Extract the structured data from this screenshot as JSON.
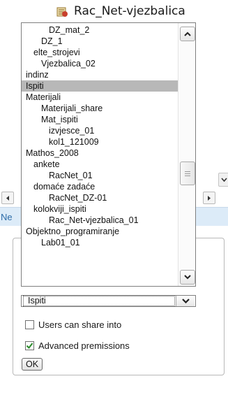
{
  "background": {
    "tree_top_item": "Rac_Net-vjezbalica",
    "status_text": "Ne"
  },
  "folder_list": {
    "items": [
      {
        "label": "DZ_mat_2",
        "indent": 3
      },
      {
        "label": "DZ_1",
        "indent": 2
      },
      {
        "label": "elte_strojevi",
        "indent": 1
      },
      {
        "label": "Vjezbalica_02",
        "indent": 2
      },
      {
        "label": "indinz",
        "indent": 0
      },
      {
        "label": "Ispiti",
        "indent": 0,
        "selected": true
      },
      {
        "label": "Materijali",
        "indent": 0
      },
      {
        "label": "Materijali_share",
        "indent": 2
      },
      {
        "label": "Mat_ispiti",
        "indent": 2
      },
      {
        "label": "izvjesce_01",
        "indent": 3
      },
      {
        "label": "kol1_121009",
        "indent": 3
      },
      {
        "label": "Mathos_2008",
        "indent": 0
      },
      {
        "label": "ankete",
        "indent": 1
      },
      {
        "label": "RacNet_01",
        "indent": 3
      },
      {
        "label": "domaće zadaće",
        "indent": 1
      },
      {
        "label": "RacNet_DZ-01",
        "indent": 3
      },
      {
        "label": "kolokviji_ispiti",
        "indent": 1
      },
      {
        "label": "Rac_Net-vjezbalica_01",
        "indent": 3
      },
      {
        "label": "Objektno_programiranje",
        "indent": 0
      },
      {
        "label": "Lab01_01",
        "indent": 2
      }
    ]
  },
  "folder_select": {
    "value": "Ispiti"
  },
  "options": {
    "users_can_share_label": "Users can share into",
    "users_can_share_checked": false,
    "advanced_permissions_label": "Advanced premissions",
    "advanced_permissions_checked": true
  },
  "ok_button_label": "OK",
  "colors": {
    "selection": "#b8b8b8",
    "status_strip": "#dcebf8",
    "status_text": "#2d6ca8"
  }
}
